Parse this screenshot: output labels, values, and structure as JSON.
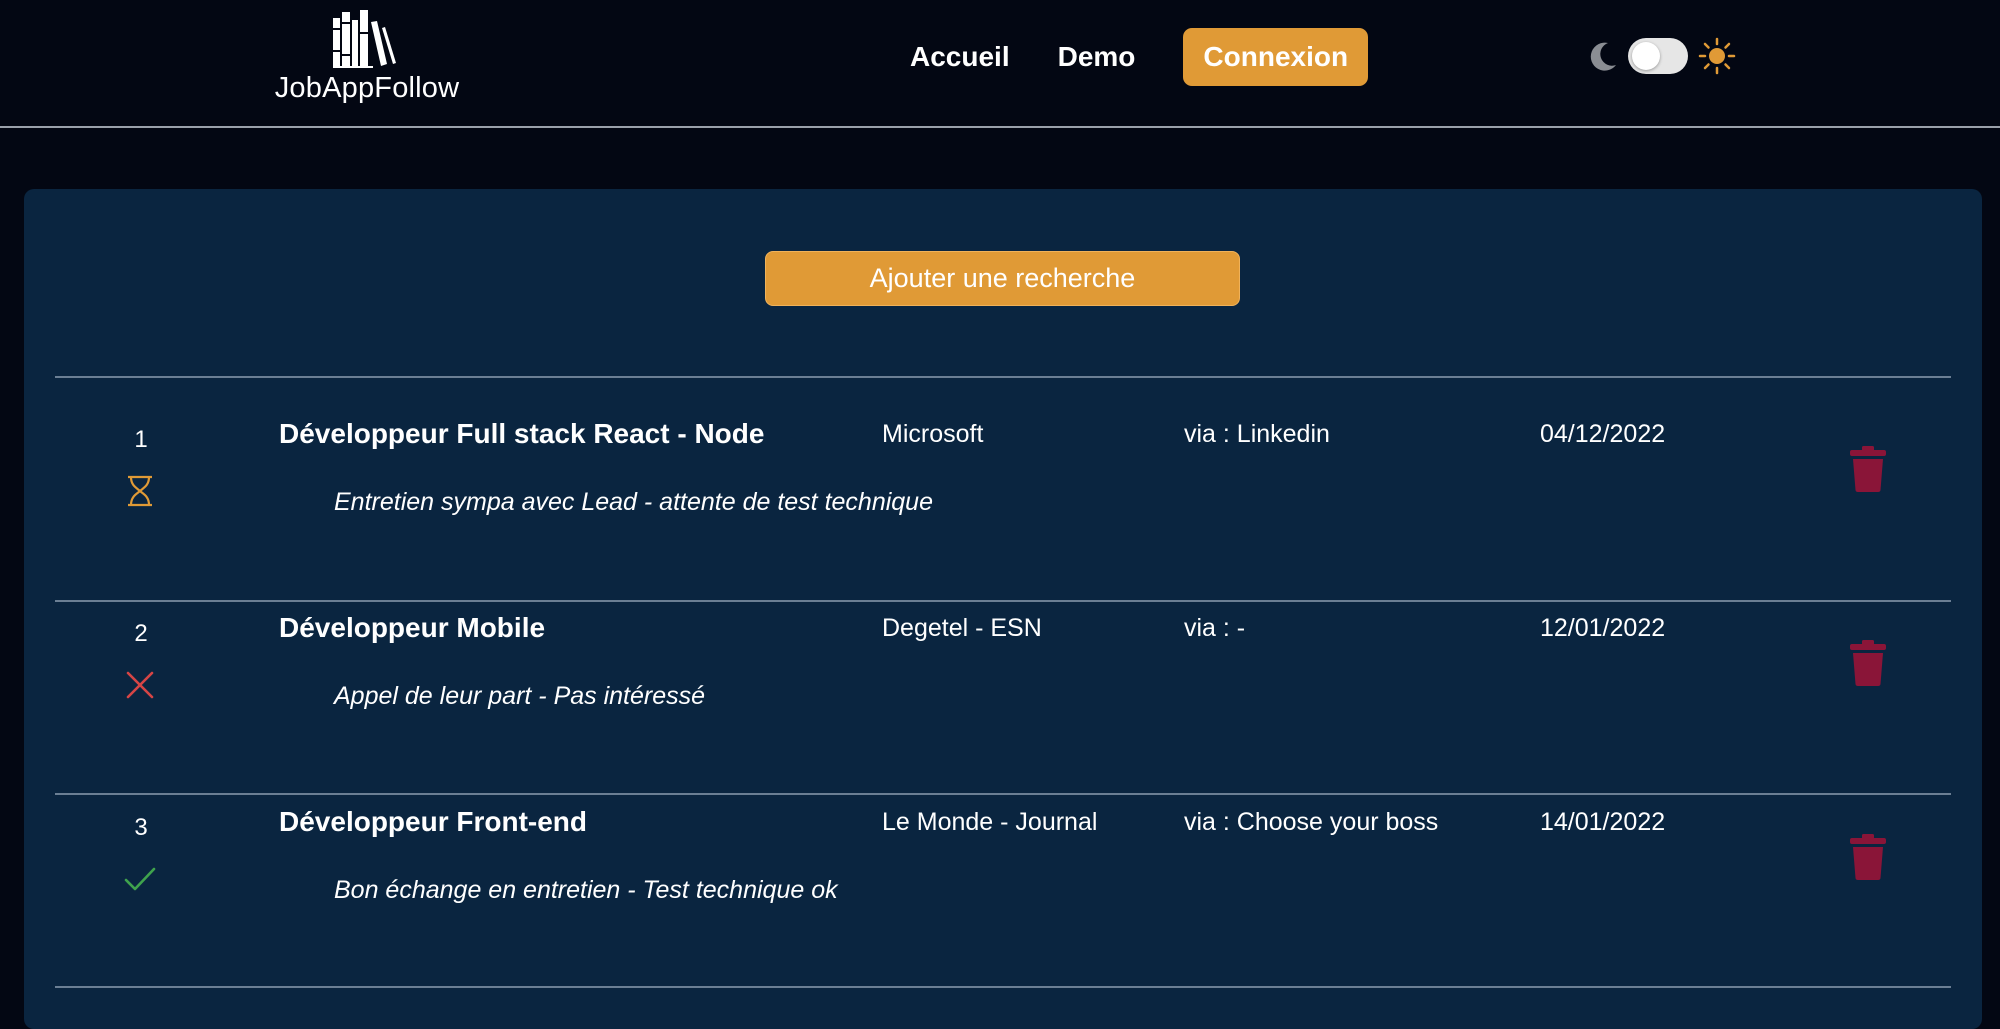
{
  "header": {
    "logo_text": "JobAppFollow",
    "nav": {
      "home_label": "Accueil",
      "demo_label": "Demo",
      "login_label": "Connexion"
    },
    "theme_toggle": {
      "moon_icon": "moon-icon",
      "sun_icon": "sun-icon",
      "state": "off"
    }
  },
  "main": {
    "add_button_label": "Ajouter une recherche",
    "applications": [
      {
        "number": "1",
        "status": "pending",
        "status_icon": "hourglass-icon",
        "title": "Développeur Full stack React - Node",
        "company": "Microsoft",
        "via": "via : Linkedin",
        "date": "04/12/2022",
        "note": "Entretien sympa avec Lead - attente de test technique"
      },
      {
        "number": "2",
        "status": "rejected",
        "status_icon": "cross-icon",
        "title": "Développeur Mobile",
        "company": "Degetel - ESN",
        "via": "via : -",
        "date": "12/01/2022",
        "note": "Appel de leur part - Pas intéressé"
      },
      {
        "number": "3",
        "status": "accepted",
        "status_icon": "check-icon",
        "title": "Développeur Front-end",
        "company": "Le Monde - Journal",
        "via": "via : Choose your boss",
        "date": "14/01/2022",
        "note": "Bon échange en entretien - Test technique ok"
      }
    ]
  },
  "colors": {
    "background": "#030713",
    "panel": "#0a2540",
    "accent": "#e09a36",
    "pending": "#e09a36",
    "rejected": "#d64545",
    "accepted": "#3fa34d",
    "delete": "#8a1538"
  }
}
